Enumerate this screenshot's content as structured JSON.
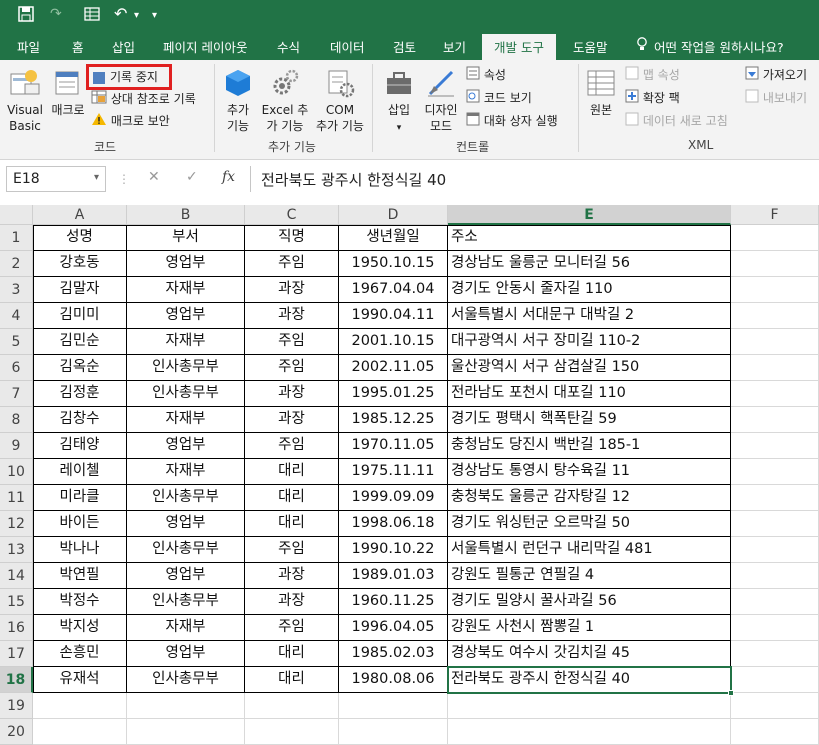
{
  "qat": {
    "undo_arrow": "↶",
    "more": "▾"
  },
  "tabs": [
    "파일",
    "홈",
    "삽입",
    "페이지 레이아웃",
    "수식",
    "데이터",
    "검토",
    "보기",
    "개발 도구",
    "도움말"
  ],
  "active_tab": "개발 도구",
  "tell_me": "어떤 작업을 원하시나요?",
  "ribbon": {
    "code": {
      "visual_basic": [
        "Visual",
        "Basic"
      ],
      "macro": "매크로",
      "stop_recording": "기록 중지",
      "relative_ref": "상대 참조로 기록",
      "macro_security": "매크로 보안",
      "label": "코드"
    },
    "addins": {
      "addins": [
        "추가",
        "기능"
      ],
      "excel_addins": [
        "Excel 추",
        "가 기능"
      ],
      "com_addins": [
        "COM",
        "추가 기능"
      ],
      "label": "추가 기능"
    },
    "controls": {
      "insert": "삽입",
      "design_mode": [
        "디자인",
        "모드"
      ],
      "properties": "속성",
      "view_code": "코드 보기",
      "run_dialog": "대화 상자 실행",
      "label": "컨트롤"
    },
    "xml": {
      "source": "원본",
      "map_properties": "맵 속성",
      "expansion_packs": "확장 팩",
      "refresh_data": "데이터 새로 고침",
      "import": "가져오기",
      "export": "내보내기",
      "label": "XML"
    }
  },
  "formula_bar": {
    "name_box": "E18",
    "fx": "fx",
    "value": "전라북도 광주시 한정식길 40"
  },
  "columns": [
    "A",
    "B",
    "C",
    "D",
    "E",
    "F"
  ],
  "selected_cell": {
    "col": "E",
    "row": 18
  },
  "rows": [
    [
      "성명",
      "부서",
      "직명",
      "생년월일",
      "주소"
    ],
    [
      "강호동",
      "영업부",
      "주임",
      "1950.10.15",
      "경상남도 울릉군 모니터길 56"
    ],
    [
      "김말자",
      "자재부",
      "과장",
      "1967.04.04",
      "경기도 안동시 줄자길 110"
    ],
    [
      "김미미",
      "영업부",
      "과장",
      "1990.04.11",
      "서울특별시 서대문구 대박길 2"
    ],
    [
      "김민순",
      "자재부",
      "주임",
      "2001.10.15",
      "대구광역시 서구 장미길 110-2"
    ],
    [
      "김옥순",
      "인사총무부",
      "주임",
      "2002.11.05",
      "울산광역시 서구 삼겹살길 150"
    ],
    [
      "김정훈",
      "인사총무부",
      "과장",
      "1995.01.25",
      "전라남도 포천시 대포길 110"
    ],
    [
      "김창수",
      "자재부",
      "과장",
      "1985.12.25",
      "경기도 평택시 핵폭탄길 59"
    ],
    [
      "김태양",
      "영업부",
      "주임",
      "1970.11.05",
      "충청남도 당진시 백반길 185-1"
    ],
    [
      "레이첼",
      "자재부",
      "대리",
      "1975.11.11",
      "경상남도 통영시 탕수육길 11"
    ],
    [
      "미라클",
      "인사총무부",
      "대리",
      "1999.09.09",
      "충청북도 울릉군 감자탕길 12"
    ],
    [
      "바이든",
      "영업부",
      "대리",
      "1998.06.18",
      "경기도 워싱턴군 오르막길 50"
    ],
    [
      "박나나",
      "인사총무부",
      "주임",
      "1990.10.22",
      "서울특별시 런던구 내리막길 481"
    ],
    [
      "박연필",
      "영업부",
      "과장",
      "1989.01.03",
      "강원도 필통군 연필길 4"
    ],
    [
      "박정수",
      "인사총무부",
      "과장",
      "1960.11.25",
      "경기도 밀양시 꿀사과길 56"
    ],
    [
      "박지성",
      "자재부",
      "주임",
      "1996.04.05",
      "강원도 사천시 짬뽕길 1"
    ],
    [
      "손흥민",
      "영업부",
      "대리",
      "1985.02.03",
      "경상북도 여수시 갓김치길 45"
    ],
    [
      "유재석",
      "인사총무부",
      "대리",
      "1980.08.06",
      "전라북도 광주시 한정식길 40"
    ],
    [
      "",
      "",
      "",
      "",
      ""
    ],
    [
      "",
      "",
      "",
      "",
      ""
    ]
  ],
  "colors": {
    "accent": "#217346",
    "highlight": "#e02020"
  }
}
